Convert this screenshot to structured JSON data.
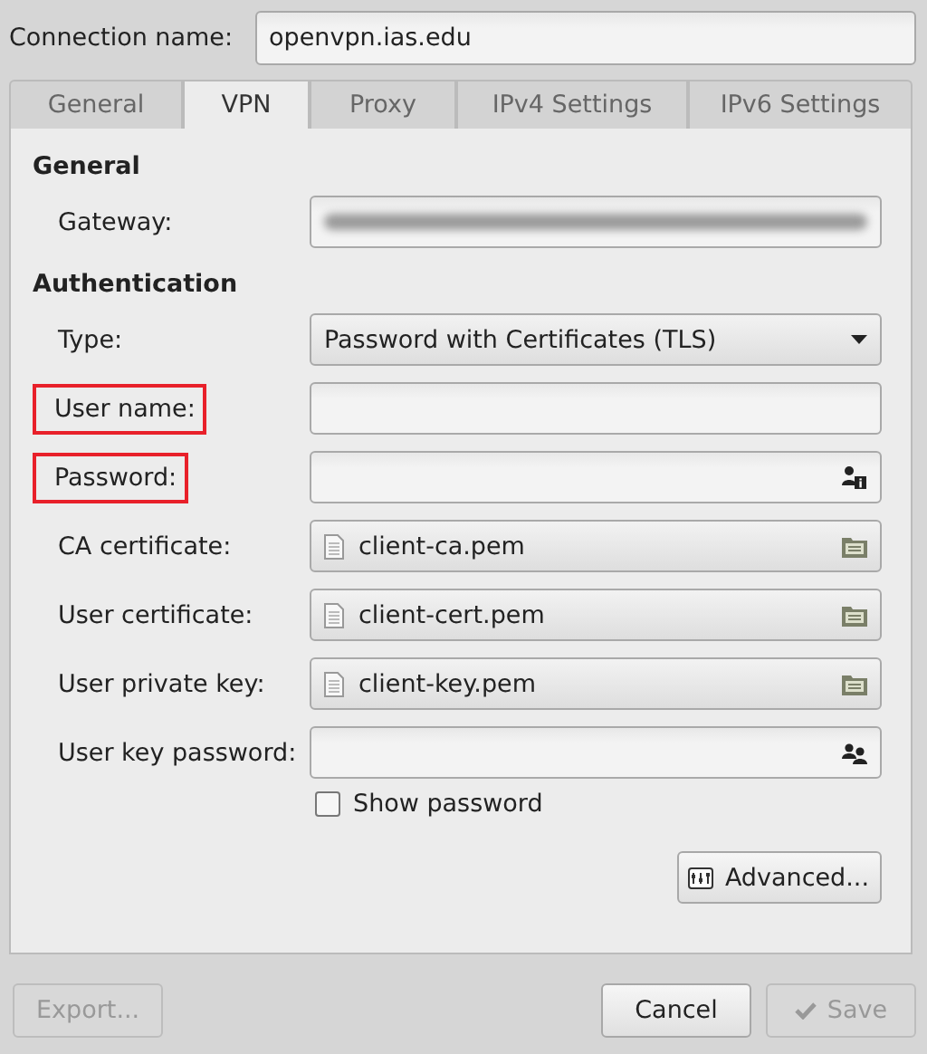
{
  "connection_name": {
    "label": "Connection name:",
    "value": "openvpn.ias.edu"
  },
  "tabs": [
    {
      "label": "General",
      "selected": false
    },
    {
      "label": "VPN",
      "selected": true
    },
    {
      "label": "Proxy",
      "selected": false
    },
    {
      "label": "IPv4 Settings",
      "selected": false
    },
    {
      "label": "IPv6 Settings",
      "selected": false
    }
  ],
  "sections": [
    {
      "title": "General",
      "rows": [
        {
          "label": "Gateway:",
          "kind": "redacted",
          "highlighted": false
        }
      ]
    },
    {
      "title": "Authentication",
      "rows": [
        {
          "label": "Type:",
          "kind": "combo",
          "value": "Password with Certificates (TLS)",
          "highlighted": false
        },
        {
          "label": "User name:",
          "kind": "entry",
          "highlighted": true
        },
        {
          "label": "Password:",
          "kind": "userpass",
          "highlighted": true
        },
        {
          "label": "CA certificate:",
          "kind": "file",
          "value": "client-ca.pem",
          "highlighted": false
        },
        {
          "label": "User certificate:",
          "kind": "file",
          "value": "client-cert.pem",
          "highlighted": false
        },
        {
          "label": "User private key:",
          "kind": "file",
          "value": "client-key.pem",
          "highlighted": false
        },
        {
          "label": "User key password:",
          "kind": "sharedpass",
          "highlighted": false
        }
      ]
    }
  ],
  "show_password": {
    "label": "Show password",
    "checked": false
  },
  "advanced_button": "Advanced...",
  "footer": {
    "export": {
      "label": "Export...",
      "disabled": true
    },
    "cancel": {
      "label": "Cancel",
      "disabled": false
    },
    "save": {
      "label": "Save",
      "disabled": true
    }
  }
}
